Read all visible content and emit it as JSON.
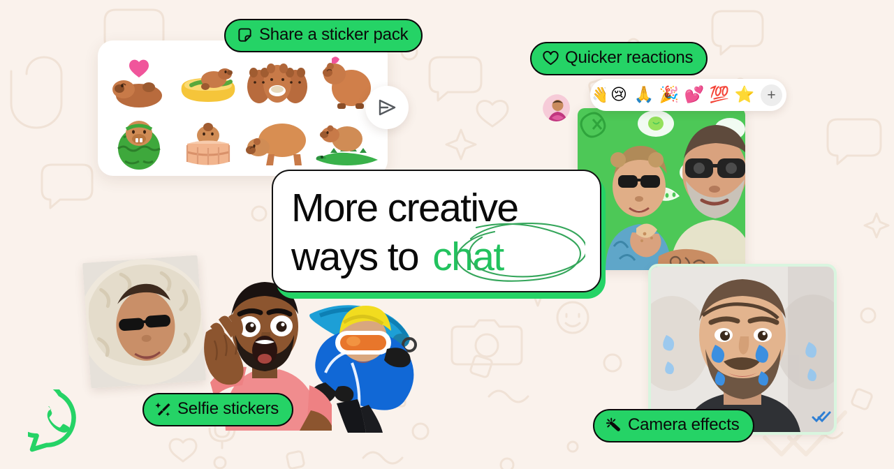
{
  "brand": {
    "name": "WhatsApp",
    "logo_icon": "whatsapp-logo-icon",
    "green": "#25D366",
    "green_text": "#22C25E",
    "background": "#FAF2EC",
    "outline": "#0A0A0A"
  },
  "headline": {
    "line1": "More creative",
    "line2_prefix": "ways to ",
    "line2_highlight": "chat",
    "highlight_annotation": "hand-drawn-ellipse"
  },
  "labels": {
    "share_sticker_pack": {
      "text": "Share a sticker pack",
      "icon": "sticker-icon"
    },
    "quicker_reactions": {
      "text": "Quicker reactions",
      "icon": "heart-outline-icon"
    },
    "selfie_stickers": {
      "text": "Selfie stickers",
      "icon": "magic-wand-sparkle-icon"
    },
    "camera_effects": {
      "text": "Camera effects",
      "icon": "magic-wand-icon"
    }
  },
  "sticker_tray": {
    "send_button_icon": "send-plane-icon",
    "stickers": [
      {
        "name": "capybara-with-heart",
        "alt": "capybara lying down with pink heart"
      },
      {
        "name": "capybara-hot-dog",
        "alt": "capybara in a hot dog bun"
      },
      {
        "name": "capybara-trio-tea",
        "alt": "three capybaras sharing tea"
      },
      {
        "name": "capybara-waving",
        "alt": "capybara sitting with pink leaf on head"
      },
      {
        "name": "capybara-watermelon",
        "alt": "capybara inside a watermelon"
      },
      {
        "name": "capybara-hot-tub",
        "alt": "capybara in a wooden hot tub"
      },
      {
        "name": "capybara-walking",
        "alt": "capybara walking"
      },
      {
        "name": "capybara-on-crocodile",
        "alt": "capybara standing on a crocodile"
      }
    ]
  },
  "reactions": {
    "avatar": "contact-avatar",
    "emojis": [
      "👋",
      "😢",
      "🙏",
      "🎉",
      "💕",
      "💯",
      "⭐"
    ],
    "add_label": "+"
  },
  "photos": {
    "couple": {
      "name": "couple-selfie-green-background",
      "alt": "woman in sunglasses and bearded man smiling in front of a green food-doodle backdrop"
    },
    "camera_effect": {
      "name": "man-with-tears-filter",
      "alt": "man with blue cartoon tear drops camera effect on his face"
    },
    "selfie_a": {
      "name": "woman-fur-hood-sticker",
      "alt": "woman in cream fur hood with dark sunglasses pouting"
    },
    "selfie_b": {
      "name": "man-pink-shirt-sticker",
      "alt": "man in pink t-shirt with surprised shocked expression"
    },
    "selfie_c": {
      "name": "snowboarder-sticker",
      "alt": "snowboarder in blue jacket with yellow helmet and orange goggles"
    }
  }
}
